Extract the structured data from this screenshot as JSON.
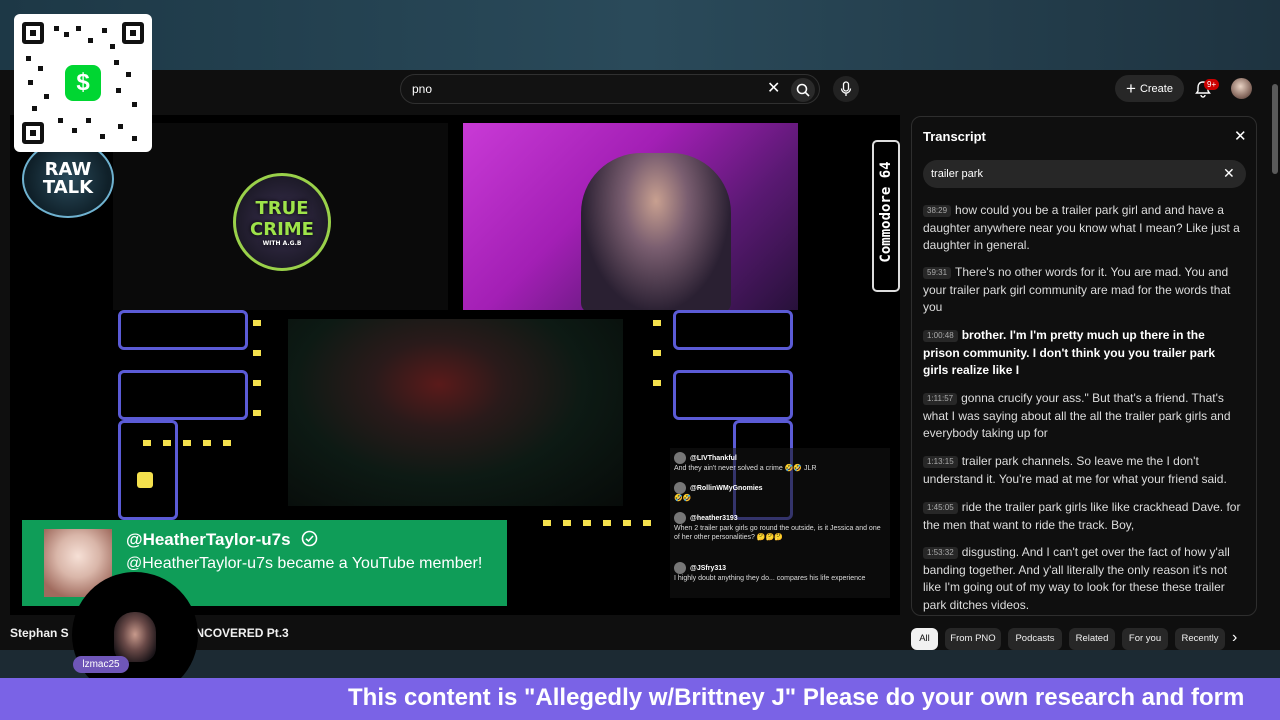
{
  "search": {
    "query": "pno"
  },
  "masthead": {
    "create_label": "Create",
    "notification_count": "9+"
  },
  "player": {
    "true_crime_logo": {
      "line1": "TRUE",
      "line2": "CRIME",
      "sub": "WITH A.G.B"
    },
    "raw_talk_logo": {
      "line1": "RAW",
      "line2": "TALK"
    },
    "side_sign": "Commodore 64",
    "chat": [
      {
        "user": "@LIVThankful",
        "text": "And they ain't never solved a crime 🤣🤣 JLR"
      },
      {
        "user": "@RollinWMyGnomies",
        "text": "🤣🤣"
      },
      {
        "user": "@heather3193",
        "text": "When 2 trailer park girls go round the outside, is it Jessica and one of her other personalities? 🤔🤔🤔"
      },
      {
        "user": "@JSfry313",
        "text": "I highly doubt anything they do... compares his life experience"
      }
    ],
    "member_alert": {
      "name": "@HeatherTaylor-u7s",
      "message": "@HeatherTaylor-u7s became a YouTube member!"
    }
  },
  "video_title": "Stephan S                               o YouTuber Pen Pal UNCOVERED Pt.3",
  "transcript": {
    "title": "Transcript",
    "search_value": "trailer park",
    "segments": [
      {
        "time": "38:29",
        "text": "how could you be a trailer park girl and and have a daughter anywhere near you know what I mean? Like just a daughter in general."
      },
      {
        "time": "59:31",
        "text": "There's no other words for it. You are mad. You and your trailer park girl community are mad for the words that you"
      },
      {
        "time": "1:00:48",
        "text": "brother. I'm I'm pretty much up there in the prison community. I don't think you you trailer park girls realize like I"
      },
      {
        "time": "1:11:57",
        "text": "gonna crucify your ass.\" But that's a friend. That's what I was saying about all the all the trailer park girls and everybody taking up for"
      },
      {
        "time": "1:13:15",
        "text": "trailer park channels. So leave me the I don't understand it. You're mad at me for what your friend said."
      },
      {
        "time": "1:45:05",
        "text": "ride the trailer park girls like like crackhead Dave. for the men that want to ride the track. Boy,"
      },
      {
        "time": "1:53:32",
        "text": "disgusting. And I can't get over the fact of how y'all banding together. And y'all literally the only reason it's not like I'm going out of my way to look for these these trailer park ditches videos."
      }
    ]
  },
  "chips": [
    "All",
    "From PNO",
    "Podcasts",
    "Related",
    "For you",
    "Recently"
  ],
  "overlay": {
    "webcam_name": "lzmac25",
    "ticker": "This content is \"Allegedly w/Brittney J\" Please do your own research and form"
  },
  "colors": {
    "member_green": "#0f9d58",
    "ticker_purple": "#7a63e6",
    "cashapp_green": "#00d632"
  }
}
